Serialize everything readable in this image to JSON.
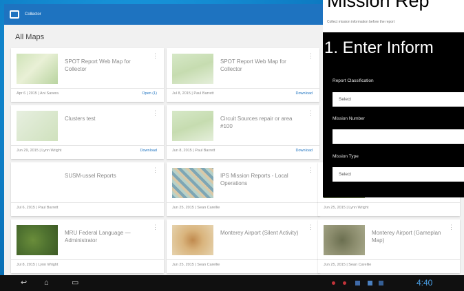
{
  "app": {
    "title": "Collector",
    "section": "All Maps"
  },
  "cards": [
    {
      "title": "SPOT Report Web Map for Collector",
      "meta": "Apr 6 | 2015 | Ani Savera",
      "action": "Open (1)"
    },
    {
      "title": "SPOT Report Web Map for Collector",
      "meta": "Jul 8, 2015 | Paul Barrett",
      "action": "Download"
    },
    {
      "title": "Clusters test",
      "meta": "Jun 29, 2015 | Lynn Wright",
      "action": "Download"
    },
    {
      "title": "Circuit Sources repair or area #100",
      "meta": "Jun 8, 2015 | Paul Barrett",
      "action": "Download"
    },
    {
      "title": "SUSM-ussel Reports",
      "meta": "Jul 6, 2015 | Paul Barrett",
      "action": ""
    },
    {
      "title": "IPS Mission Reports - Local Operations",
      "meta": "Jun 25, 2015 | Sean Carellie",
      "action": ""
    },
    {
      "title": "MRU Federal Language — Administrator",
      "meta": "Jul 8, 2015 | Lynn Wright",
      "action": ""
    },
    {
      "title": "Monterey Airport (Silent Activity)",
      "meta": "Jun 25, 2015 | Sean Carellie",
      "action": ""
    },
    {
      "title": "Monterey Airport (Gameplan Map)",
      "meta": "Jun 25, 2015 | Sean Carellie",
      "action": ""
    },
    {
      "title": "",
      "meta": "Jun 25, 2015 | Lynn Wright",
      "action": ""
    }
  ],
  "overlay": {
    "title": "Mission Rep",
    "subtitle": "Collect mission information before the report",
    "step": "1. Enter Inform",
    "fields": [
      {
        "label": "Report Classification",
        "value": "Select"
      },
      {
        "label": "Mission Number",
        "value": ""
      },
      {
        "label": "Mission Type",
        "value": "Select"
      }
    ]
  },
  "status": {
    "clock": "4:40"
  }
}
